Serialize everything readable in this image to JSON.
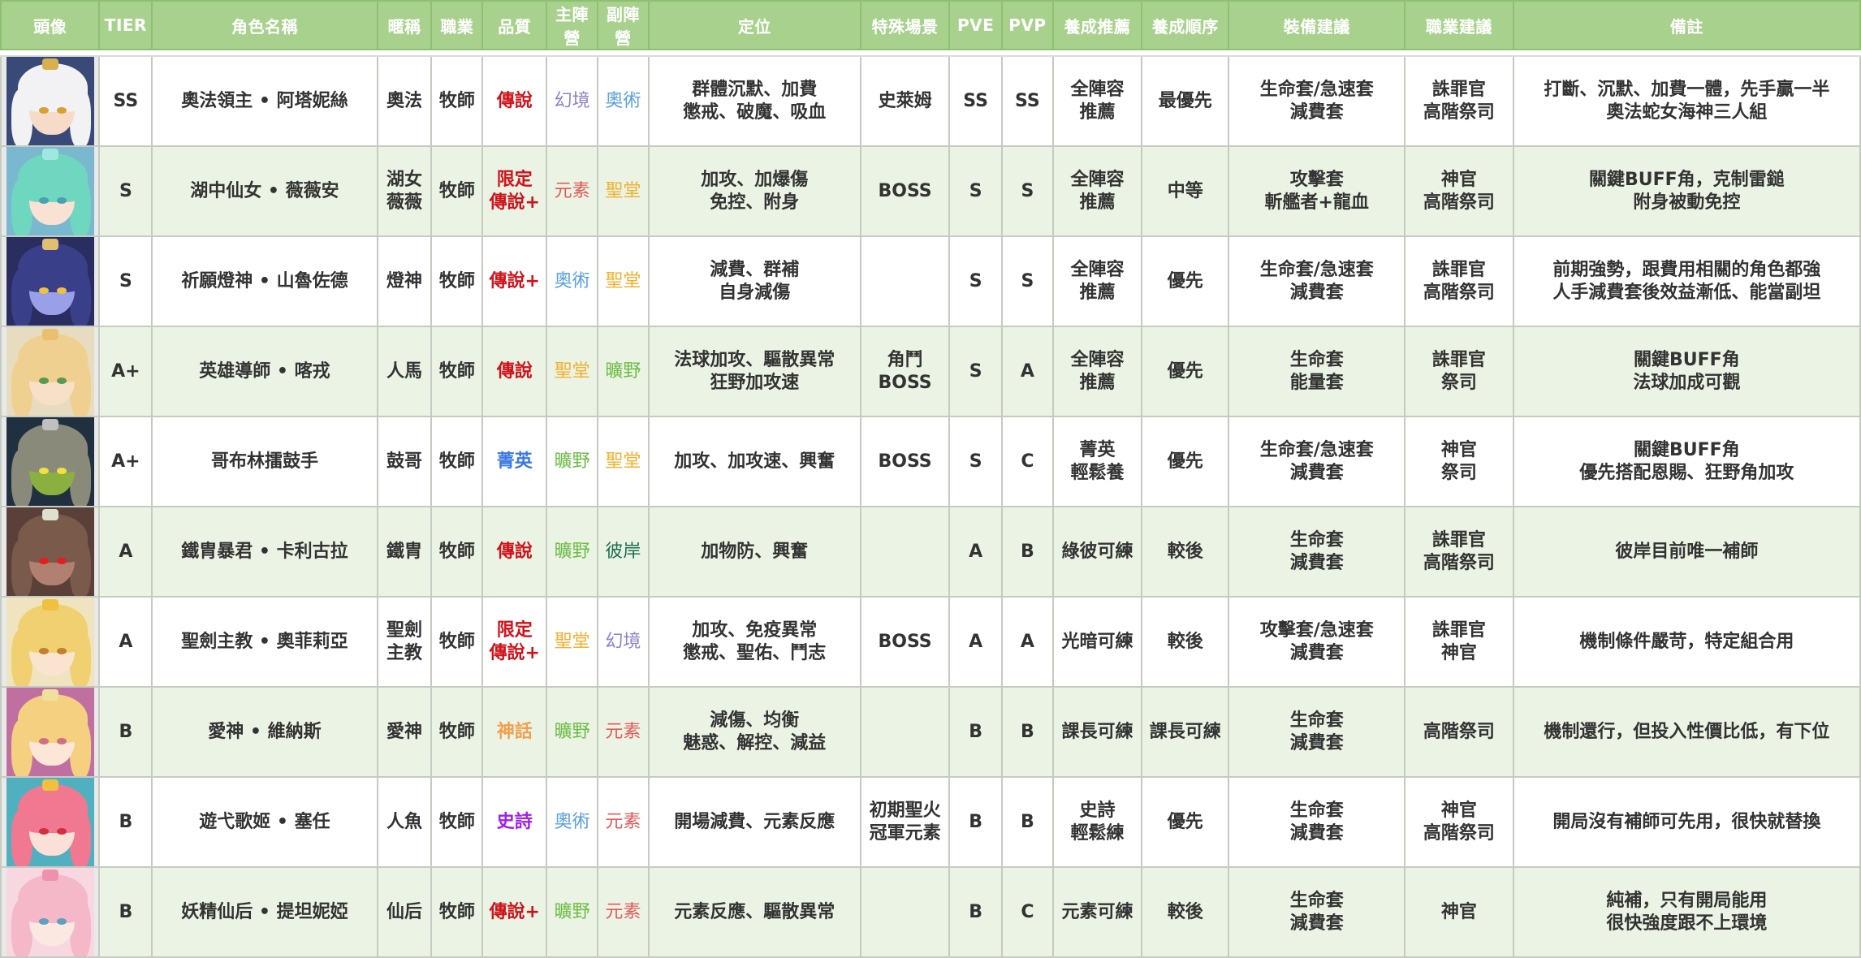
{
  "headers": [
    "頭像",
    "TIER",
    "角色名稱",
    "暱稱",
    "職業",
    "品質",
    "主陣營",
    "副陣營",
    "定位",
    "特殊場景",
    "PVE",
    "PVP",
    "養成推薦",
    "養成順序",
    "裝備建議",
    "職業建議",
    "備註"
  ],
  "colors": {
    "header_bg": "#a9d18e",
    "row_alt": "#ebf4e4",
    "quality": {
      "傳說": "#d0121b",
      "限定傳說+": "#d0121b",
      "傳說+": "#d0121b",
      "菁英": "#3b78e0",
      "神話": "#f0a050",
      "史詩": "#a020f0"
    },
    "faction": {
      "幻境": "#8f7fcf",
      "奧術": "#5aa0e0",
      "元素": "#e05a5a",
      "聖堂": "#f0b030",
      "曠野": "#6cbb45",
      "彼岸": "#1e6f4f"
    }
  },
  "rows": [
    {
      "tier": "SS",
      "name": "奧法領主 • 阿塔妮絲",
      "nick": "奧法",
      "job": "牧師",
      "quality": "傳說",
      "quality_color": "#d0121b",
      "main": "幻境",
      "main_color": "#8f7fcf",
      "sub": "奧術",
      "sub_color": "#5aa0e0",
      "role": "群體沉默、加費\n懲戒、破魔、吸血",
      "scene": "史萊姆",
      "pve": "SS",
      "pvp": "SS",
      "train": "全陣容\n推薦",
      "order": "最優先",
      "equip": "生命套/急速套\n減費套",
      "class": "誅罪官\n高階祭司",
      "note": "打斷、沉默、加費一體，先手贏一半\n奧法蛇女海神三人組",
      "portrait": {
        "hair": "#f2f2f4",
        "skin": "#f6dcc8",
        "eye": "#d8a030",
        "acc": "#d8b050",
        "bg": "#3a4a78"
      }
    },
    {
      "tier": "S",
      "name": "湖中仙女 • 薇薇安",
      "nick": "湖女\n薇薇",
      "job": "牧師",
      "quality": "限定\n傳說+",
      "quality_color": "#d0121b",
      "main": "元素",
      "main_color": "#e05a5a",
      "sub": "聖堂",
      "sub_color": "#f0b030",
      "role": "加攻、加爆傷\n免控、附身",
      "scene": "BOSS",
      "pve": "S",
      "pvp": "S",
      "train": "全陣容\n推薦",
      "order": "中等",
      "equip": "攻擊套\n斬艦者+龍血",
      "class": "神官\n高階祭司",
      "note": "關鍵BUFF角，克制雷鎚\n附身被動免控",
      "portrait": {
        "hair": "#6fd6bf",
        "skin": "#f9e2d4",
        "eye": "#4aa0b0",
        "acc": "#9fe8e0",
        "bg": "#7ab8d0"
      }
    },
    {
      "tier": "S",
      "name": "祈願燈神 • 山魯佐德",
      "nick": "燈神",
      "job": "牧師",
      "quality": "傳說+",
      "quality_color": "#d0121b",
      "main": "奧術",
      "main_color": "#5aa0e0",
      "sub": "聖堂",
      "sub_color": "#f0b030",
      "role": "減費、群補\n自身減傷",
      "scene": "",
      "pve": "S",
      "pvp": "S",
      "train": "全陣容\n推薦",
      "order": "優先",
      "equip": "生命套/急速套\n減費套",
      "class": "誅罪官\n高階祭司",
      "note": "前期強勢，跟費用相關的角色都強\n人手減費套後效益漸低、能當副坦",
      "portrait": {
        "hair": "#3a3f8a",
        "skin": "#9aa0e8",
        "eye": "#f0c040",
        "acc": "#e0c070",
        "bg": "#2a2d60"
      }
    },
    {
      "tier": "A+",
      "name": "英雄導師 • 喀戎",
      "nick": "人馬",
      "job": "牧師",
      "quality": "傳說",
      "quality_color": "#d0121b",
      "main": "聖堂",
      "main_color": "#f0b030",
      "sub": "曠野",
      "sub_color": "#6cbb45",
      "role": "法球加攻、驅散異常\n狂野加攻速",
      "scene": "角鬥\nBOSS",
      "pve": "S",
      "pvp": "A",
      "train": "全陣容\n推薦",
      "order": "優先",
      "equip": "生命套\n能量套",
      "class": "誅罪官\n祭司",
      "note": "關鍵BUFF角\n法球加成可觀",
      "portrait": {
        "hair": "#f0d090",
        "skin": "#f8e0c8",
        "eye": "#5a9a50",
        "acc": "#e8c070",
        "bg": "#e8dcc0"
      }
    },
    {
      "tier": "A+",
      "name": "哥布林擂鼓手",
      "nick": "鼓哥",
      "job": "牧師",
      "quality": "菁英",
      "quality_color": "#3b78e0",
      "main": "曠野",
      "main_color": "#6cbb45",
      "sub": "聖堂",
      "sub_color": "#f0b030",
      "role": "加攻、加攻速、興奮",
      "scene": "BOSS",
      "pve": "S",
      "pvp": "C",
      "train": "菁英\n輕鬆養",
      "order": "優先",
      "equip": "生命套/急速套\n減費套",
      "class": "神官\n祭司",
      "note": "關鍵BUFF角\n優先搭配恩賜、狂野角加攻",
      "portrait": {
        "hair": "#8a8a7a",
        "skin": "#8cb040",
        "eye": "#f0e040",
        "acc": "#c0c0c0",
        "bg": "#203040"
      }
    },
    {
      "tier": "A",
      "name": "鐵胄暴君 • 卡利古拉",
      "nick": "鐵胄",
      "job": "牧師",
      "quality": "傳說",
      "quality_color": "#d0121b",
      "main": "曠野",
      "main_color": "#6cbb45",
      "sub": "彼岸",
      "sub_color": "#1e6f4f",
      "role": "加物防、興奮",
      "scene": "",
      "pve": "A",
      "pvp": "B",
      "train": "綠彼可練",
      "order": "較後",
      "equip": "生命套\n減費套",
      "class": "誅罪官\n高階祭司",
      "note": "彼岸目前唯一補師",
      "portrait": {
        "hair": "#7a5a4a",
        "skin": "#b08070",
        "eye": "#e02020",
        "acc": "#e0e0d0",
        "bg": "#5a4038"
      }
    },
    {
      "tier": "A",
      "name": "聖劍主教 • 奧菲莉亞",
      "nick": "聖劍\n主教",
      "job": "牧師",
      "quality": "限定\n傳說+",
      "quality_color": "#d0121b",
      "main": "聖堂",
      "main_color": "#f0b030",
      "sub": "幻境",
      "sub_color": "#8f7fcf",
      "role": "加攻、免疫異常\n懲戒、聖佑、鬥志",
      "scene": "BOSS",
      "pve": "A",
      "pvp": "A",
      "train": "光暗可練",
      "order": "較後",
      "equip": "攻擊套/急速套\n減費套",
      "class": "誅罪官\n神官",
      "note": "機制條件嚴苛，特定組合用",
      "portrait": {
        "hair": "#f0d070",
        "skin": "#fae4d0",
        "eye": "#c08030",
        "acc": "#f0c040",
        "bg": "#f0e4c0"
      }
    },
    {
      "tier": "B",
      "name": "愛神 • 維納斯",
      "nick": "愛神",
      "job": "牧師",
      "quality": "神話",
      "quality_color": "#f0a050",
      "main": "曠野",
      "main_color": "#6cbb45",
      "sub": "元素",
      "sub_color": "#e05a5a",
      "role": "減傷、均衡\n魅惑、解控、減益",
      "scene": "",
      "pve": "B",
      "pvp": "B",
      "train": "課長可練",
      "order": "課長可練",
      "equip": "生命套\n減費套",
      "class": "高階祭司",
      "note": "機制還行，但投入性價比低，有下位",
      "portrait": {
        "hair": "#f4d080",
        "skin": "#fbe6d8",
        "eye": "#d07080",
        "acc": "#f0e0a0",
        "bg": "#c070a0"
      }
    },
    {
      "tier": "B",
      "name": "遊弋歌姬 • 塞任",
      "nick": "人魚",
      "job": "牧師",
      "quality": "史詩",
      "quality_color": "#a020f0",
      "main": "奧術",
      "main_color": "#5aa0e0",
      "sub": "元素",
      "sub_color": "#e05a5a",
      "role": "開場減費、元素反應",
      "scene": "初期聖火\n冠軍元素",
      "pve": "B",
      "pvp": "B",
      "train": "史詩\n輕鬆練",
      "order": "優先",
      "equip": "生命套\n減費套",
      "class": "神官\n高階祭司",
      "note": "開局沒有補師可先用，很快就替換",
      "portrait": {
        "hair": "#f07890",
        "skin": "#fbe0d8",
        "eye": "#d03040",
        "acc": "#f0c040",
        "bg": "#50b0c0"
      }
    },
    {
      "tier": "B",
      "name": "妖精仙后 • 提坦妮婭",
      "nick": "仙后",
      "job": "牧師",
      "quality": "傳說+",
      "quality_color": "#d0121b",
      "main": "曠野",
      "main_color": "#6cbb45",
      "sub": "元素",
      "sub_color": "#e05a5a",
      "role": "元素反應、驅散異常",
      "scene": "",
      "pve": "B",
      "pvp": "C",
      "train": "元素可練",
      "order": "較後",
      "equip": "生命套\n減費套",
      "class": "神官",
      "note": "純補，只有開局能用\n很快強度跟不上環境",
      "portrait": {
        "hair": "#f4b8c8",
        "skin": "#fbe8e0",
        "eye": "#60a0c0",
        "acc": "#f090b0",
        "bg": "#f8d8e0"
      }
    }
  ]
}
